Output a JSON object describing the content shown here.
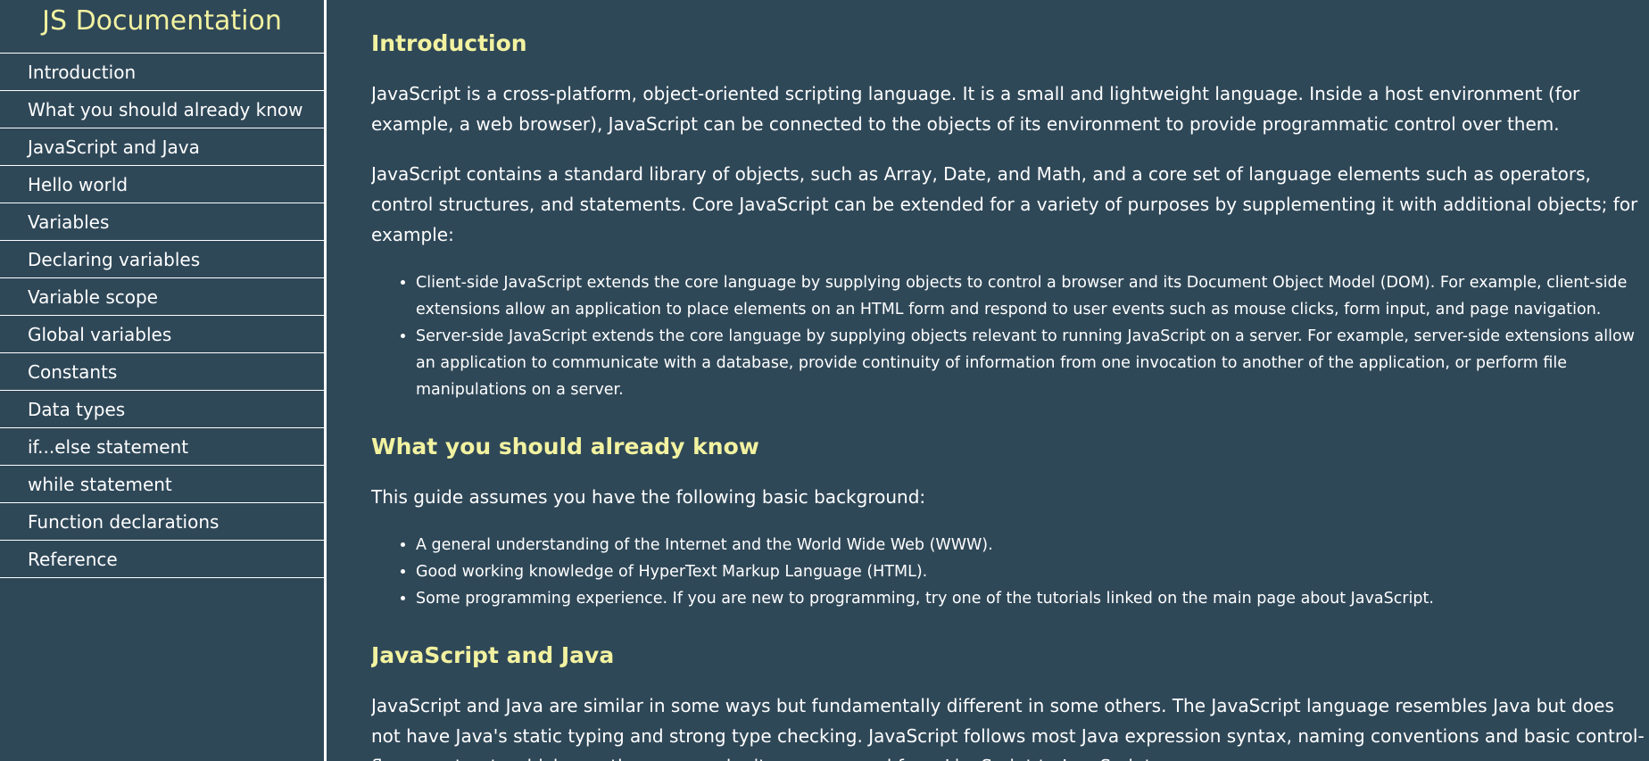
{
  "navbar": {
    "title": "JS Documentation",
    "items": [
      "Introduction",
      "What you should already know",
      "JavaScript and Java",
      "Hello world",
      "Variables",
      "Declaring variables",
      "Variable scope",
      "Global variables",
      "Constants",
      "Data types",
      "if...else statement",
      "while statement",
      "Function declarations",
      "Reference"
    ]
  },
  "sections": {
    "introduction": {
      "title": "Introduction",
      "p1": "JavaScript is a cross-platform, object-oriented scripting language. It is a small and lightweight language. Inside a host environment (for example, a web browser), JavaScript can be connected to the objects of its environment to provide programmatic control over them.",
      "p2": "JavaScript contains a standard library of objects, such as Array, Date, and Math, and a core set of language elements such as operators, control structures, and statements. Core JavaScript can be extended for a variety of purposes by supplementing it with additional objects; for example:",
      "list": [
        "Client-side JavaScript extends the core language by supplying objects to control a browser and its Document Object Model (DOM). For example, client-side extensions allow an application to place elements on an HTML form and respond to user events such as mouse clicks, form input, and page navigation.",
        "Server-side JavaScript extends the core language by supplying objects relevant to running JavaScript on a server. For example, server-side extensions allow an application to communicate with a database, provide continuity of information from one invocation to another of the application, or perform file manipulations on a server."
      ]
    },
    "already_know": {
      "title": "What you should already know",
      "p1": "This guide assumes you have the following basic background:",
      "list": [
        "A general understanding of the Internet and the World Wide Web (WWW).",
        "Good working knowledge of HyperText Markup Language (HTML).",
        "Some programming experience. If you are new to programming, try one of the tutorials linked on the main page about JavaScript."
      ]
    },
    "js_and_java": {
      "title": "JavaScript and Java",
      "p1": "JavaScript and Java are similar in some ways but fundamentally different in some others. The JavaScript language resembles Java but does not have Java's static typing and strong type checking. JavaScript follows most Java expression syntax, naming conventions and basic control-flow constructs which was the reason why it was renamed from LiveScript to JavaScript."
    }
  }
}
